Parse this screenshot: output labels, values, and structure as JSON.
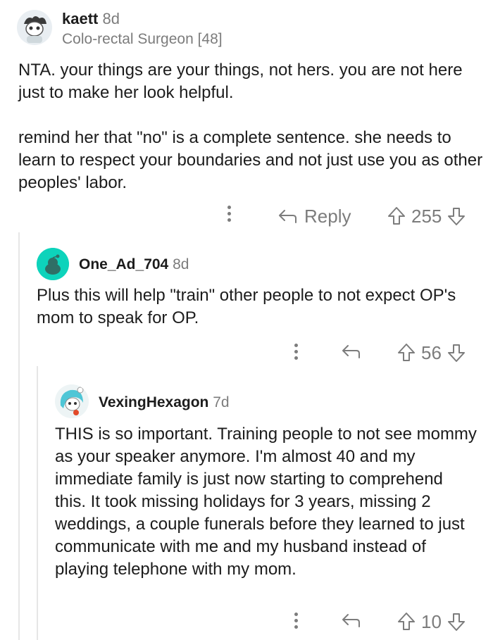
{
  "comments": [
    {
      "username": "kaett",
      "age": "8d",
      "flair": "Colo-rectal Surgeon [48]",
      "paragraphs": [
        "NTA.  your things are your things, not hers.  you are not here just to make her look helpful.",
        "remind her that \"no\" is a complete sentence.  she needs to learn to respect your boundaries and not just use you as other peoples' labor."
      ],
      "reply_label": "Reply",
      "score": "255"
    },
    {
      "username": "One_Ad_704",
      "age": "8d",
      "paragraphs": [
        "Plus this will help \"train\" other people to not expect OP's mom to speak for OP."
      ],
      "score": "56"
    },
    {
      "username": "VexingHexagon",
      "age": "7d",
      "paragraphs": [
        "THIS is so important. Training people to not see mommy as your speaker anymore. I'm almost 40 and my immediate family is just now starting to comprehend this. It took missing holidays for 3 years, missing 2 weddings, a couple funerals before they learned to just communicate with me and my husband instead of playing telephone with my mom."
      ],
      "score": "10"
    }
  ],
  "icons": {
    "more": "more-icon",
    "reply": "reply-arrow-icon",
    "upvote": "upvote-arrow-icon",
    "downvote": "downvote-arrow-icon"
  },
  "colors": {
    "text": "#1c1c1c",
    "meta": "#7c7c7c",
    "avatar_teal": "#0dd3bb"
  }
}
